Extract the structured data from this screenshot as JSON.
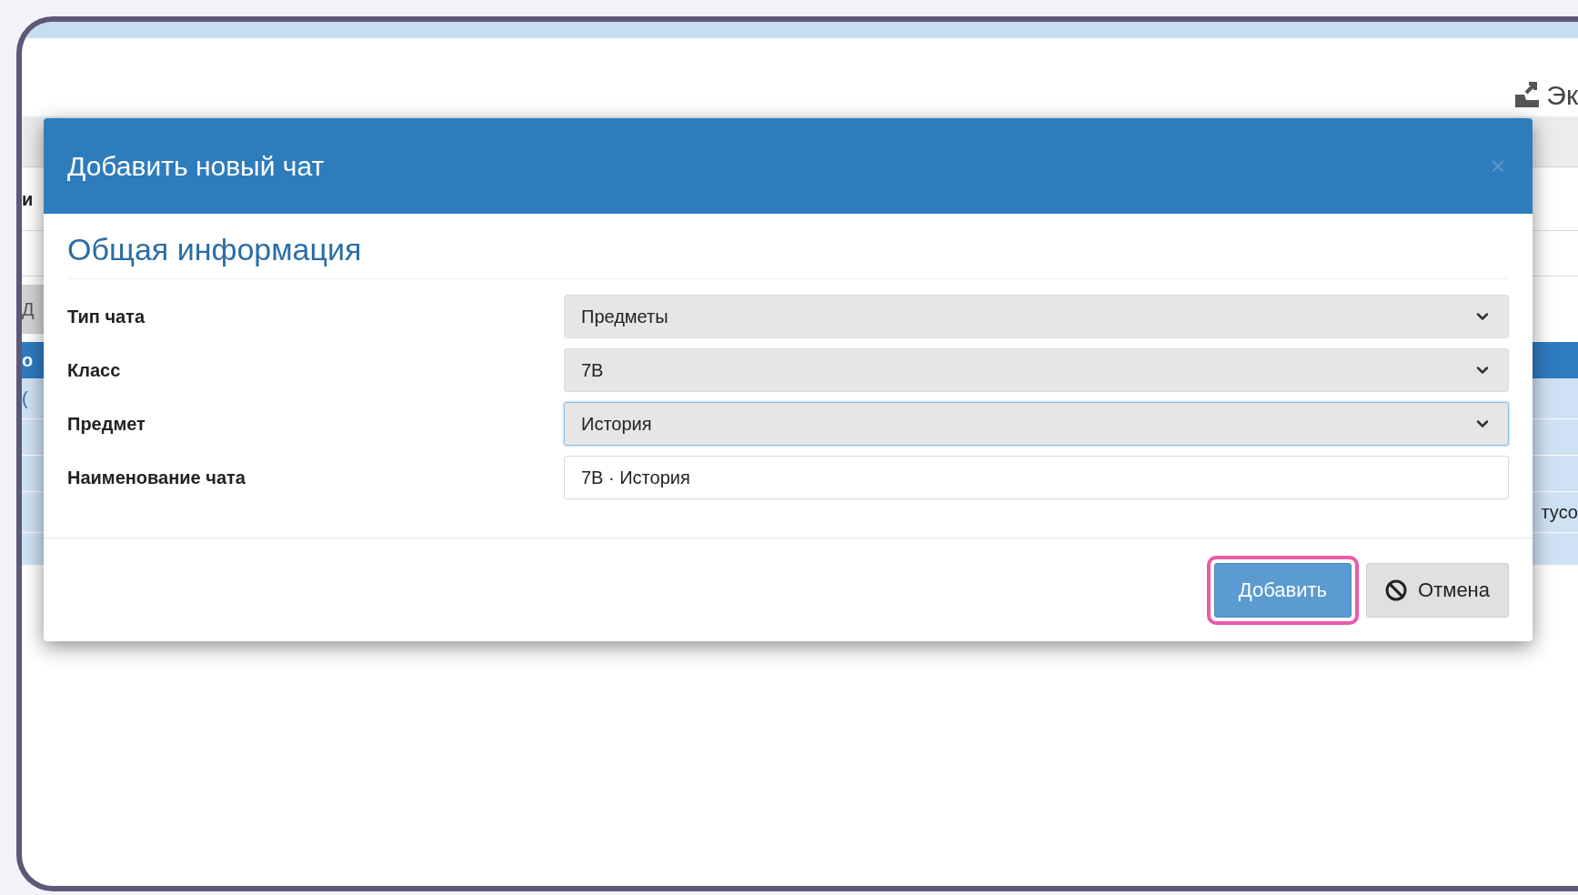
{
  "background": {
    "export_link": "Эк",
    "heading_fragment": "и",
    "button_fragment": "Д",
    "header_fragment": "о",
    "cell_fragment": "(",
    "right_fragment": "тусо"
  },
  "dialog": {
    "title": "Добавить новый чат",
    "close": "×",
    "section_title": "Общая информация",
    "fields": [
      {
        "label": "Тип чата",
        "kind": "select",
        "value": "Предметы",
        "focused": false
      },
      {
        "label": "Класс",
        "kind": "select",
        "value": "7В",
        "focused": false
      },
      {
        "label": "Предмет",
        "kind": "select",
        "value": "История",
        "focused": true
      },
      {
        "label": "Наименование чата",
        "kind": "text",
        "value": "7В · История",
        "focused": false
      }
    ],
    "buttons": [
      {
        "label": "Добавить",
        "kind": "primary",
        "highlighted": true
      },
      {
        "label": "Отмена",
        "kind": "cancel",
        "highlighted": false
      }
    ]
  }
}
